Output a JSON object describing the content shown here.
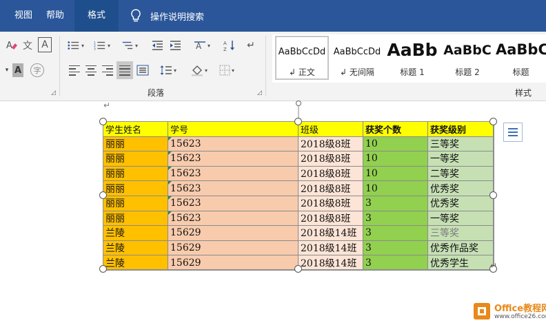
{
  "tabs": [
    {
      "label": "视图"
    },
    {
      "label": "帮助"
    },
    {
      "label": "格式",
      "selected": true
    }
  ],
  "tell_me": {
    "label": "操作说明搜索",
    "icon": "lightbulb-icon"
  },
  "ribbon": {
    "paragraph_group": {
      "label": "段落"
    },
    "styles_group": {
      "label": "样式"
    },
    "styles": [
      {
        "preview": "AaBbCcDd",
        "name": "正文",
        "selected": true
      },
      {
        "preview": "AaBbCcDd",
        "name": "无间隔"
      },
      {
        "preview": "AaBb",
        "name": "标题 1"
      },
      {
        "preview": "AaBbC",
        "name": "标题 2"
      },
      {
        "preview": "AaBbC",
        "name": "标题"
      }
    ],
    "icons": [
      "clear-formatting-icon",
      "phonetic-guide-icon",
      "character-border-icon",
      "shading-icon",
      "enclosed-character-icon",
      "bullets-icon",
      "numbering-icon",
      "multilevel-list-icon",
      "decrease-indent-icon",
      "increase-indent-icon",
      "chinese-layout-icon",
      "sort-icon",
      "show-marks-icon",
      "align-left-icon",
      "center-icon",
      "align-right-icon",
      "justify-icon",
      "distributed-icon",
      "line-spacing-icon",
      "paint-bucket-icon",
      "borders-icon"
    ]
  },
  "table": {
    "headers": [
      "学生姓名",
      "学号",
      "班级",
      "获奖个数",
      "获奖级别"
    ],
    "rows": [
      [
        "丽丽",
        "15623",
        "2018级8班",
        "10",
        "三等奖"
      ],
      [
        "丽丽",
        "15623",
        "2018级8班",
        "10",
        "一等奖"
      ],
      [
        "丽丽",
        "15623",
        "2018级8班",
        "10",
        "二等奖"
      ],
      [
        "丽丽",
        "15623",
        "2018级8班",
        "10",
        "优秀奖"
      ],
      [
        "丽丽",
        "15623",
        "2018级8班",
        "3",
        "优秀奖"
      ],
      [
        "丽丽",
        "15623",
        "2018级8班",
        "3",
        "一等奖"
      ],
      [
        "兰陵",
        "15629",
        "2018级14班",
        "3",
        "三等奖"
      ],
      [
        "兰陵",
        "15629",
        "2018级14班",
        "3",
        "优秀作品奖"
      ],
      [
        "兰陵",
        "15629",
        "2018级14班",
        "3",
        "优秀学生"
      ]
    ],
    "colors": {
      "name": "#ffc000",
      "id": "#f8cbad",
      "class": "#fce4d6",
      "count": "#92d050",
      "level": "#c6e0b4",
      "header": "#ffff00"
    }
  },
  "watermark": {
    "title": "Office教程网",
    "url": "www.office26.com"
  },
  "colors": {
    "ribbon_tab_bar": "#2b579a",
    "selected_tab": "#1f4e8c",
    "ribbon_body": "#f3f3f3"
  }
}
